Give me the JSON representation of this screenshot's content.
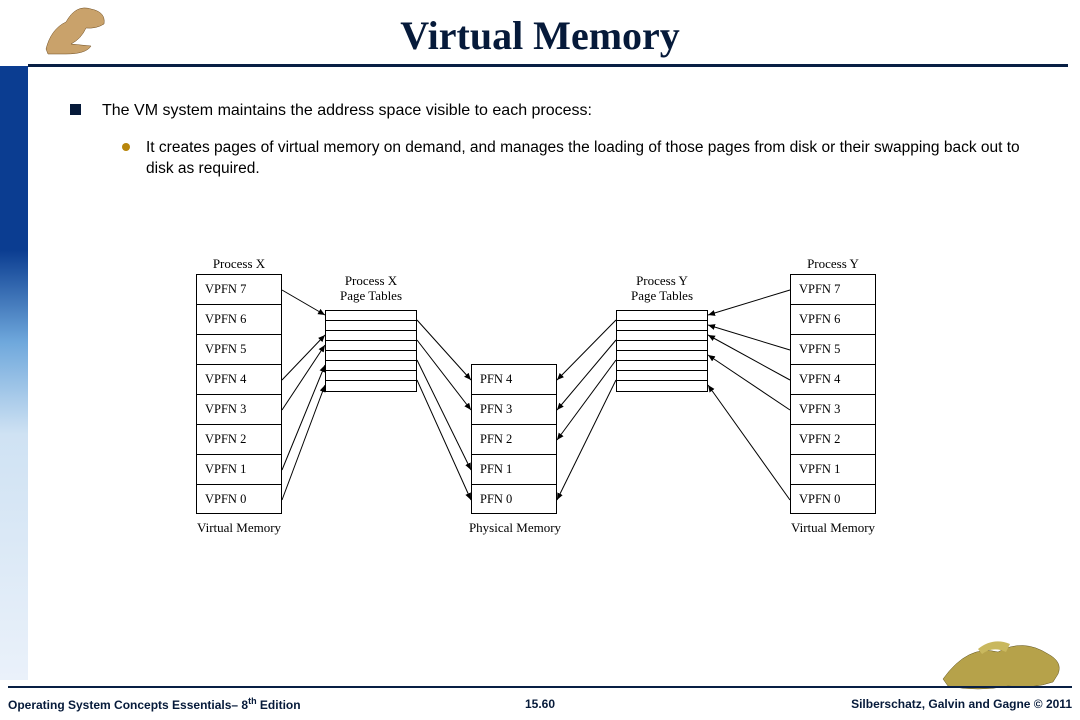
{
  "title": "Virtual Memory",
  "bullets": {
    "b1": "The VM system maintains the address space visible to each process:",
    "b2": "It creates pages of virtual memory on demand, and manages the loading of those pages from disk or their swapping back out to disk as required."
  },
  "diagram": {
    "procX": "Process X",
    "procX_pt": "Process X\nPage Tables",
    "procY": "Process Y",
    "procY_pt": "Process Y\nPage Tables",
    "vpfn": [
      "VPFN 7",
      "VPFN 6",
      "VPFN 5",
      "VPFN 4",
      "VPFN 3",
      "VPFN 2",
      "VPFN 1",
      "VPFN 0"
    ],
    "pfn": [
      "PFN 4",
      "PFN 3",
      "PFN 2",
      "PFN 1",
      "PFN 0"
    ],
    "cap_vm": "Virtual Memory",
    "cap_pm": "Physical Memory"
  },
  "footer": {
    "left_a": "Operating System Concepts Essentials– 8",
    "left_sup": "th",
    "left_b": " Edition",
    "center": "15.60",
    "right": "Silberschatz, Galvin and Gagne © 2011"
  }
}
